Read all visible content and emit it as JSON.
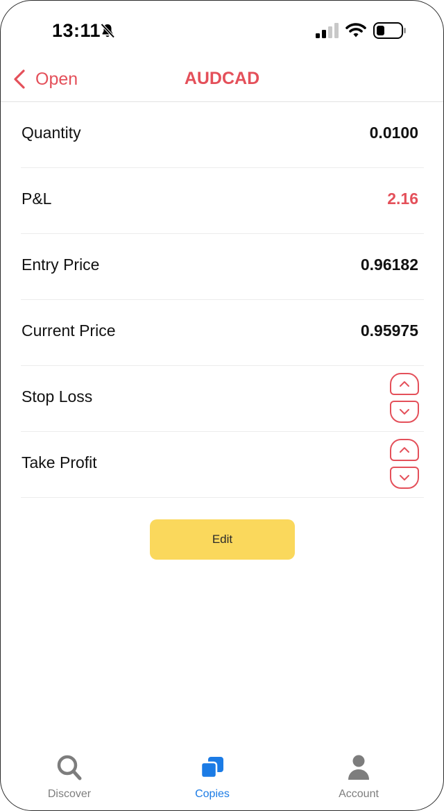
{
  "status_bar": {
    "time": "13:11",
    "icons": [
      "bell-slash-icon",
      "cellular-signal-icon",
      "wifi-icon",
      "battery-icon"
    ]
  },
  "nav": {
    "back_label": "Open",
    "title": "AUDCAD"
  },
  "rows": [
    {
      "label": "Quantity",
      "value": "0.0100"
    },
    {
      "label": "P&L",
      "value": "2.16"
    },
    {
      "label": "Entry Price",
      "value": "0.96182"
    },
    {
      "label": "Current Price",
      "value": "0.95975"
    },
    {
      "label": "Stop Loss"
    },
    {
      "label": "Take Profit"
    }
  ],
  "edit_label": "Edit",
  "tabs": [
    {
      "label": "Discover",
      "icon": "search-icon"
    },
    {
      "label": "Copies",
      "icon": "copies-icon",
      "active": true
    },
    {
      "label": "Account",
      "icon": "person-icon"
    }
  ],
  "colors": {
    "accent": "#e4505a",
    "edit_button": "#fad85c",
    "tab_active": "#1b7be5",
    "tab_inactive": "#7d7d7d"
  }
}
